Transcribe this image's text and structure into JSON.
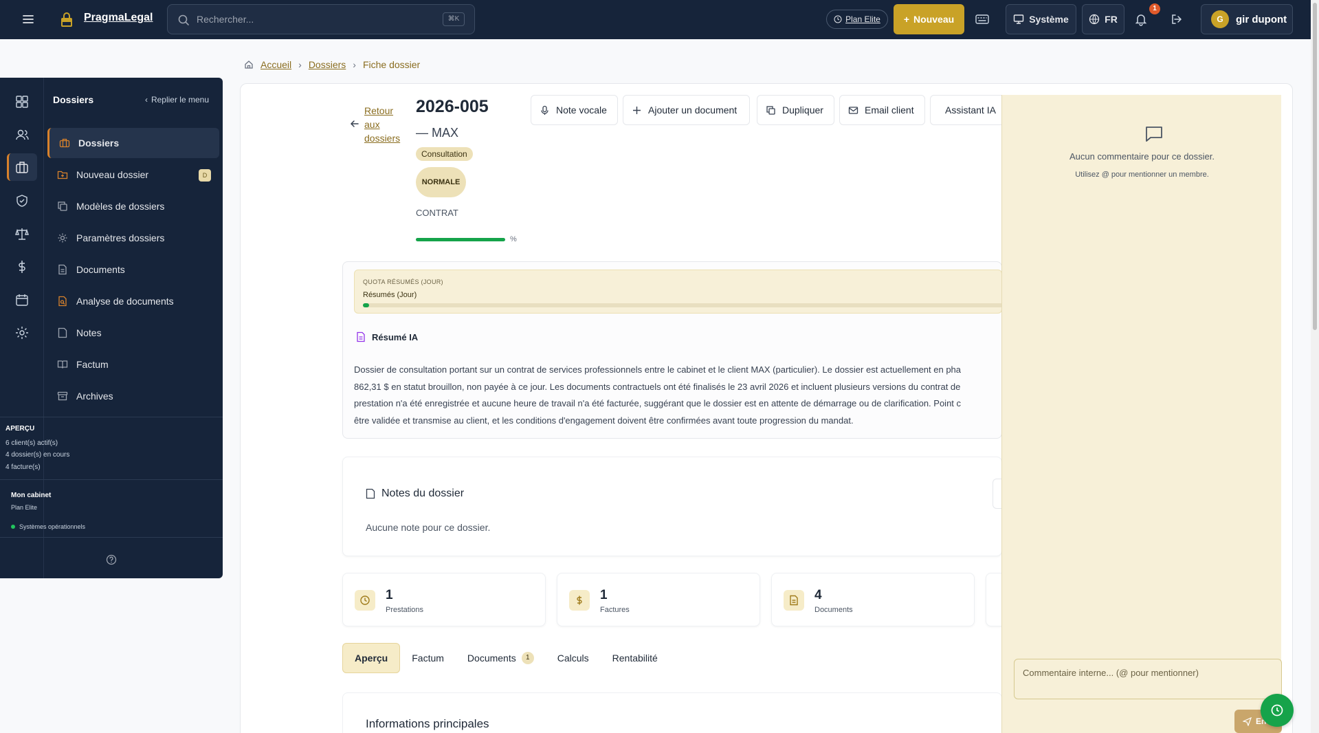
{
  "topbar": {
    "brand": "PragmaLegal",
    "search_placeholder": "Rechercher...",
    "search_shortcut": "⌘K",
    "plan": "Plan Elite",
    "new_button": "Nouveau",
    "theme_button": "Système",
    "lang_button": "FR",
    "notifications_count": "1",
    "user_initial": "G",
    "user_name": "gir dupont",
    "colors": {
      "bar": "#16243a",
      "accent": "#c9a227"
    }
  },
  "sidebar": {
    "title": "Dossiers",
    "collapse_label": "Replier le menu",
    "rail_icons": [
      "dashboard-icon",
      "users-icon",
      "briefcase-icon",
      "shield-icon",
      "scales-icon",
      "dollar-icon",
      "calendar-icon",
      "gear-icon"
    ],
    "items": [
      {
        "label": "Dossiers",
        "icon": "briefcase-icon",
        "active": true
      },
      {
        "label": "Nouveau dossier",
        "icon": "folder-plus-icon",
        "badge": "D"
      },
      {
        "label": "Modèles de dossiers",
        "icon": "copy-icon"
      },
      {
        "label": "Paramètres dossiers",
        "icon": "gear-icon"
      },
      {
        "label": "Documents",
        "icon": "file-icon"
      },
      {
        "label": "Analyse de documents",
        "icon": "file-search-icon"
      },
      {
        "label": "Notes",
        "icon": "note-icon"
      },
      {
        "label": "Factum",
        "icon": "book-icon"
      },
      {
        "label": "Archives",
        "icon": "archive-icon"
      }
    ],
    "apercu": {
      "title": "APERÇU",
      "lines": [
        "6 client(s) actif(s)",
        "4 dossier(s) en cours",
        "4 facture(s)"
      ]
    },
    "cabinet": {
      "title": "Mon cabinet",
      "plan": "Plan Elite",
      "status": "Systèmes opérationnels"
    }
  },
  "breadcrumb": {
    "home": "Accueil",
    "section": "Dossiers",
    "current": "Fiche dossier"
  },
  "dossier": {
    "back_lines": [
      "Retour",
      "aux",
      "dossiers"
    ],
    "reference": "2026-005",
    "client": "— MAX",
    "type": "Consultation",
    "priority": "NORMALE",
    "category": "CONTRAT",
    "progress_fraction": 1.0,
    "progress_label": "%"
  },
  "actions": {
    "voice_note": "Note vocale",
    "add_document": "Ajouter un document",
    "duplicate": "Dupliquer",
    "email_client": "Email client",
    "assistant": "Assistant IA"
  },
  "quota": {
    "caption": "QUOTA RÉSUMÉS (JOUR)",
    "label": "Résumés (Jour)",
    "fill_fraction": 0.01
  },
  "resume": {
    "title": "Résumé IA",
    "lines": [
      "Dossier de consultation portant sur un contrat de services professionnels entre le cabinet et le client MAX (particulier). Le dossier est actuellement en pha",
      "862,31 $ en statut brouillon, non payée à ce jour. Les documents contractuels ont été finalisés le 23 avril 2026 et incluent plusieurs versions du contrat de",
      "prestation n'a été enregistrée et aucune heure de travail n'a été facturée, suggérant que le dossier est en attente de démarrage ou de clarification. Point c",
      "être validée et transmise au client, et les conditions d'engagement doivent être confirmées avant toute progression du mandat."
    ]
  },
  "notes": {
    "title": "Notes du dossier",
    "empty": "Aucune note pour ce dossier."
  },
  "stats": [
    {
      "value": "1",
      "label": "Prestations",
      "icon": "clock-icon"
    },
    {
      "value": "1",
      "label": "Factures",
      "icon": "dollar-icon"
    },
    {
      "value": "4",
      "label": "Documents",
      "icon": "file-icon"
    }
  ],
  "tabs": [
    {
      "label": "Aperçu",
      "active": true
    },
    {
      "label": "Factum"
    },
    {
      "label": "Documents",
      "count": "1"
    },
    {
      "label": "Calculs"
    },
    {
      "label": "Rentabilité"
    }
  ],
  "info": {
    "title": "Informations principales"
  },
  "comments": {
    "empty_title": "Aucun commentaire pour ce dossier.",
    "hint": "Utilisez @ pour mentionner un membre.",
    "placeholder": "Commentaire interne... (@ pour mentionner)",
    "send": "En"
  }
}
